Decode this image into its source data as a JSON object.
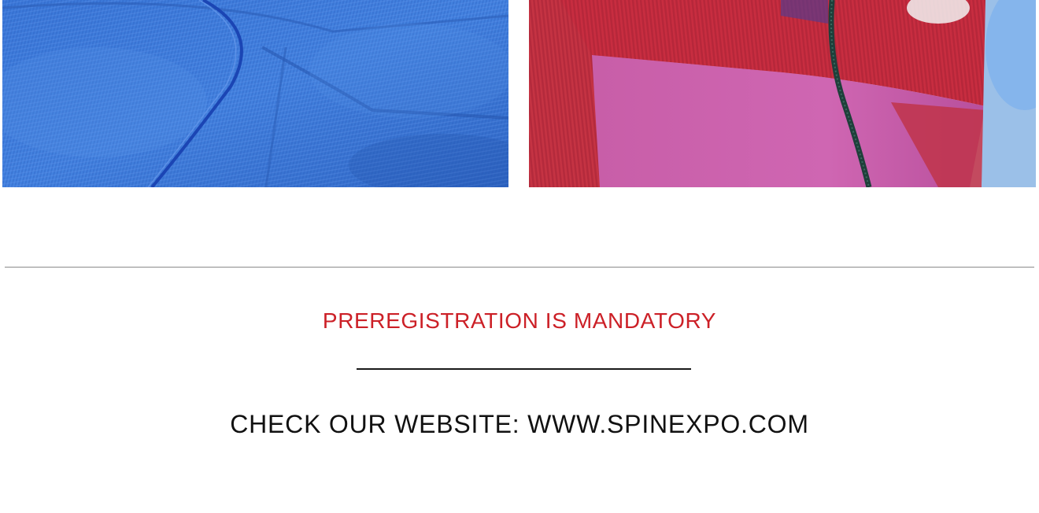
{
  "notice": {
    "text": "PREREGISTRATION IS MANDATORY",
    "color": "#cc2027"
  },
  "website": {
    "text": "CHECK OUR WEBSITE: WWW.SPINEXPO.COM"
  },
  "photos": {
    "left_subject": "blue-knit-fabric",
    "right_subject": "red-pink-zip-knit-jacket"
  }
}
